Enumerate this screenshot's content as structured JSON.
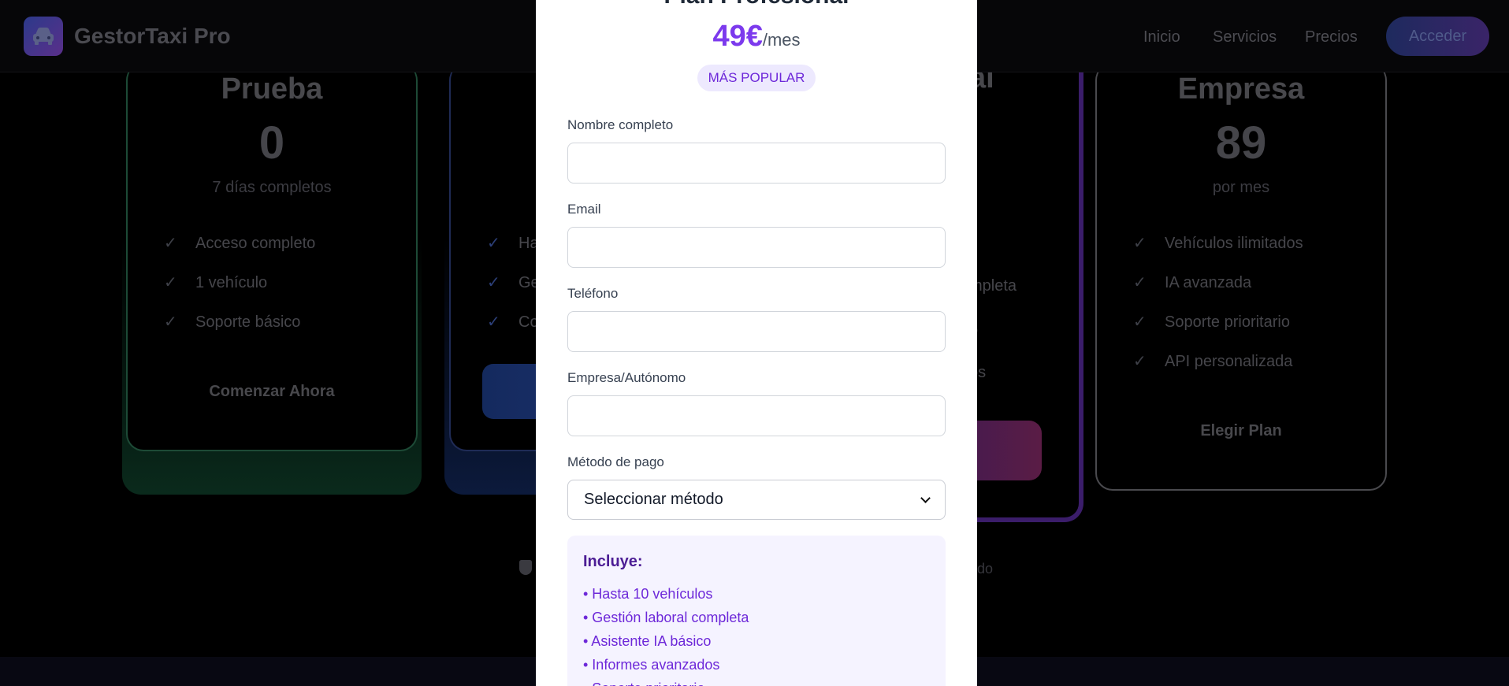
{
  "nav": {
    "brand": "GestorTaxi Pro",
    "links": [
      "Inicio",
      "Servicios",
      "Precios"
    ],
    "login": "Acceder"
  },
  "cards": [
    {
      "title": "Prueba",
      "price": "0",
      "subtitle": "7 días completos",
      "features": [
        "Acceso completo",
        "1 vehículo",
        "Soporte básico"
      ],
      "cta": "Comenzar Ahora",
      "accent": "#10b981"
    },
    {
      "title": "",
      "features": [
        "Ha",
        "Ge",
        "Co"
      ],
      "accent": "#3b82f6"
    },
    {
      "title_fragment": "al",
      "features": [
        "mpleta",
        "o",
        "os"
      ],
      "accent": "#8b5cf6"
    },
    {
      "title": "Empresa",
      "price": "89",
      "subtitle": "por mes",
      "features": [
        "Vehículos ilimitados",
        "IA avanzada",
        "Soporte prioritario",
        "API personalizada"
      ],
      "cta": "Elegir Plan",
      "accent": "#9ca3af"
    }
  ],
  "footer_fragment": "do",
  "modal": {
    "title": "Plan Profesional",
    "price": "49€",
    "period": "/mes",
    "badge": "MÁS POPULAR",
    "fields": [
      {
        "label": "Nombre completo",
        "value": ""
      },
      {
        "label": "Email",
        "value": ""
      },
      {
        "label": "Teléfono",
        "value": ""
      },
      {
        "label": "Empresa/Autónomo",
        "value": ""
      }
    ],
    "payment": {
      "label": "Método de pago",
      "selected": "Seleccionar método"
    },
    "includes": {
      "title": "Incluye:",
      "items": [
        "• Hasta 10 vehículos",
        "• Gestión laboral completa",
        "• Asistente IA básico",
        "• Informes avanzados",
        "• Soporte prioritario"
      ]
    },
    "accent": "#7c3aed"
  }
}
